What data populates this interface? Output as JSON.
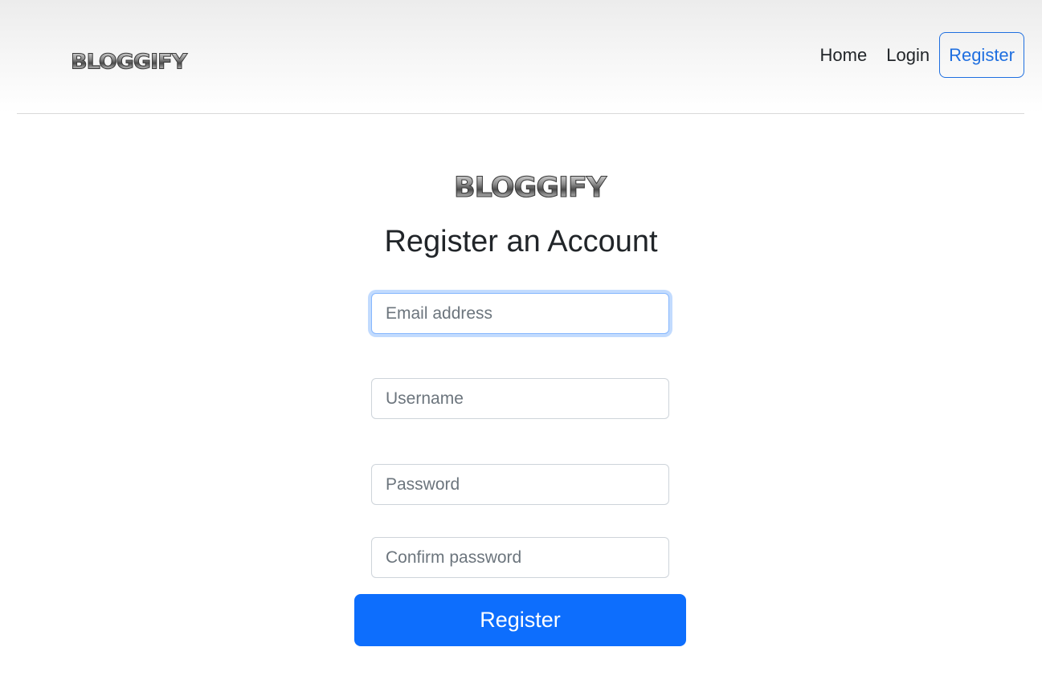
{
  "brand": {
    "logo_text": "BLOGGIFY"
  },
  "nav": {
    "items": [
      {
        "label": "Home"
      },
      {
        "label": "Login"
      },
      {
        "label": "Register",
        "active": true
      }
    ]
  },
  "form": {
    "logo_text": "BLOGGIFY",
    "title": "Register an Account",
    "email": {
      "placeholder": "Email address",
      "value": ""
    },
    "username": {
      "placeholder": "Username",
      "value": ""
    },
    "password": {
      "placeholder": "Password",
      "value": ""
    },
    "confirm_password": {
      "placeholder": "Confirm password",
      "value": ""
    },
    "submit_label": "Register"
  },
  "colors": {
    "primary": "#0d6efd",
    "nav_active": "#1f6fe0",
    "text": "#212529"
  }
}
